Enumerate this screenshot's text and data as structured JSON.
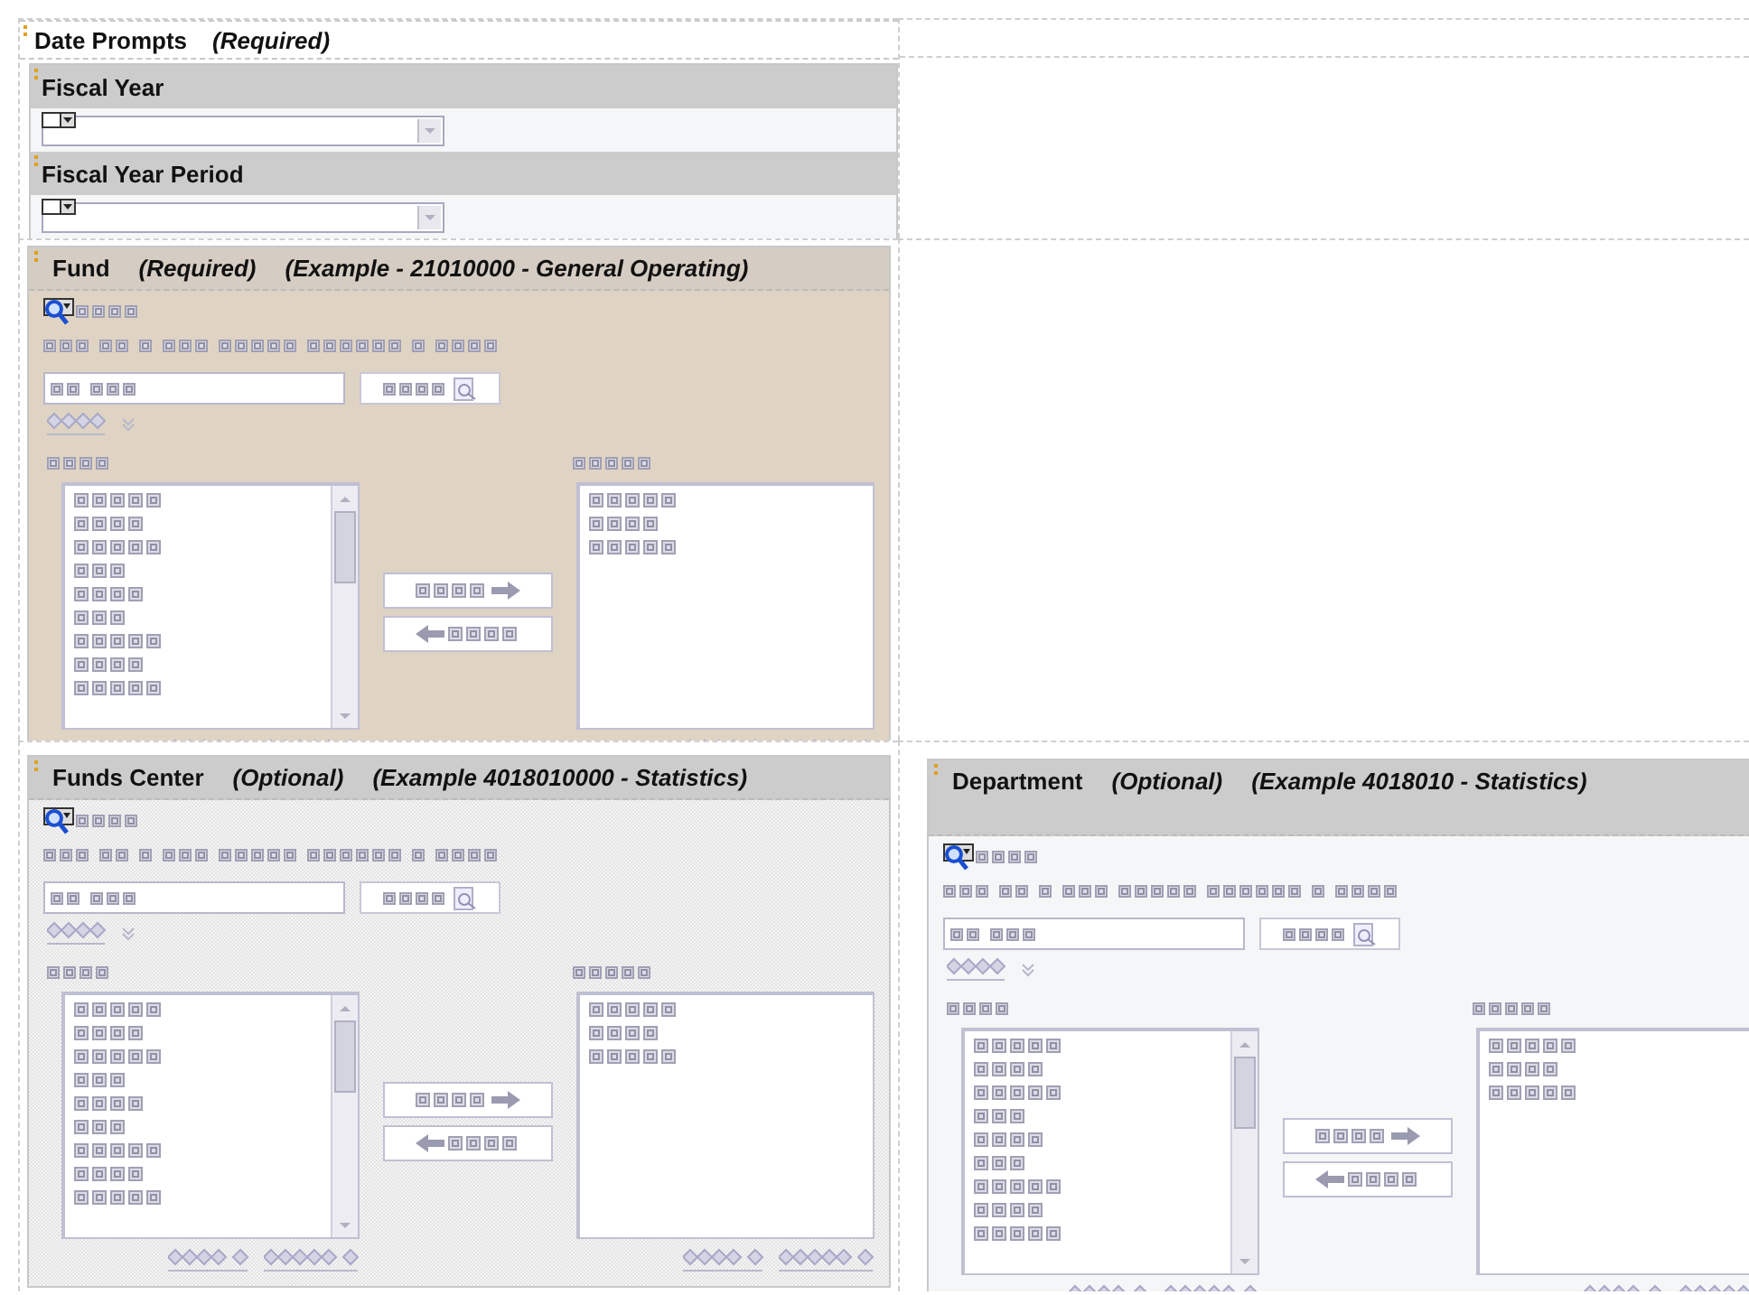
{
  "date_prompts": {
    "title": "Date Prompts",
    "note": "(Required)",
    "fields": [
      {
        "label": "Fiscal Year"
      },
      {
        "label": "Fiscal Year Period"
      }
    ]
  },
  "panels": [
    {
      "kind": "beige",
      "name": "Fund",
      "note": "(Required)",
      "example": "(Example - 21010000 - General Operating)"
    },
    {
      "kind": "stippled",
      "name": "Funds Center",
      "note": "(Optional)",
      "example": "(Example 4018010000 - Statistics)"
    },
    {
      "kind": "plain",
      "name": "Department",
      "note": "(Optional)",
      "example": "(Example 4018010 - Statistics)"
    }
  ]
}
